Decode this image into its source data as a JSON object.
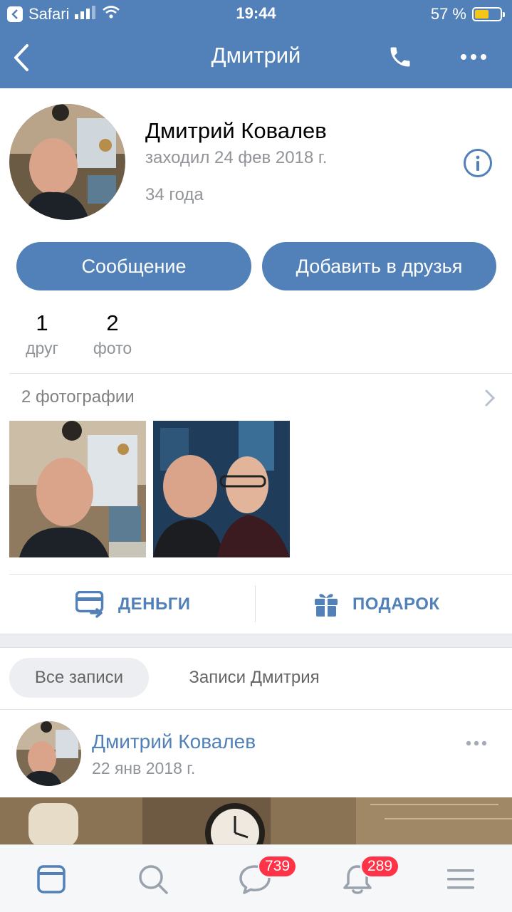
{
  "status_bar": {
    "back_app": "Safari",
    "time": "19:44",
    "battery_text": "57 %",
    "battery_level": 0.57
  },
  "nav": {
    "title": "Дмитрий",
    "icons": [
      "chevron-left-icon",
      "phone-icon",
      "more-horizontal-icon"
    ]
  },
  "profile": {
    "name": "Дмитрий Ковалев",
    "last_seen": "заходил 24 фев 2018 г.",
    "age": "34 года"
  },
  "buttons": {
    "message": "Сообщение",
    "add_friend": "Добавить в друзья"
  },
  "counters": {
    "friends": {
      "value": "1",
      "label": "друг"
    },
    "photos": {
      "value": "2",
      "label": "фото"
    }
  },
  "photos": {
    "header": "2 фотографии"
  },
  "actions": {
    "money": "ДЕНЬГИ",
    "gift": "ПОДАРОК"
  },
  "wall_tabs": {
    "all": "Все записи",
    "own": "Записи Дмитрия"
  },
  "post": {
    "author": "Дмитрий Ковалев",
    "date": "22 янв 2018 г."
  },
  "tabbar": {
    "items": [
      "feed-icon",
      "search-icon",
      "messages-icon",
      "notifications-icon",
      "menu-icon"
    ],
    "messages_badge": "739",
    "notifications_badge": "289",
    "active_color": "#5181b8",
    "inactive_color": "#99a2ad"
  },
  "colors": {
    "brand": "#5181b8",
    "badge": "#ff3347"
  }
}
